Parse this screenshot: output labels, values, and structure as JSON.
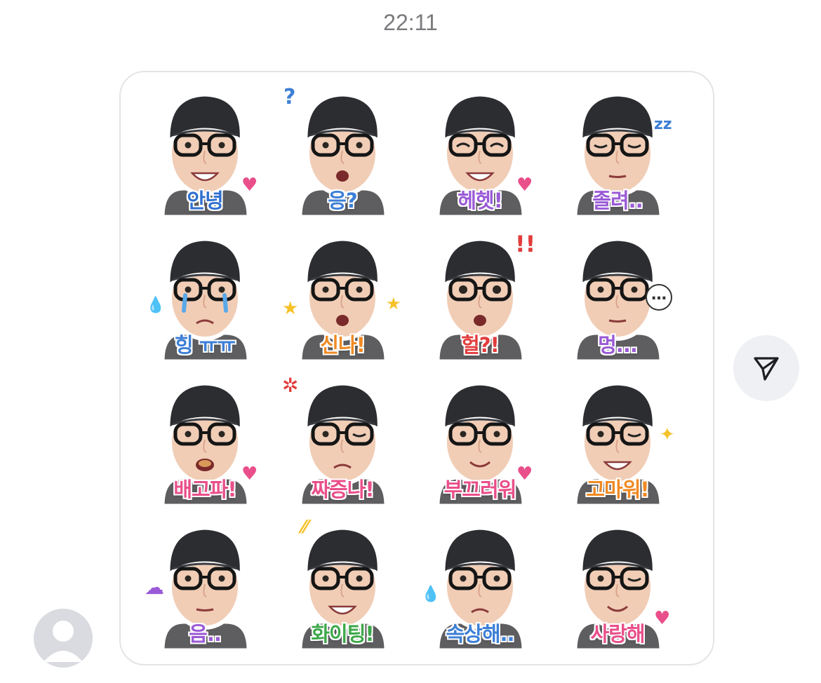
{
  "timestamp": "22:11",
  "colors": {
    "pink": "#e94f8a",
    "blue": "#3d7fd6",
    "purple": "#9a5ad6",
    "orange": "#f08a24",
    "green": "#3ea84a",
    "yellow": "#f6c22a",
    "red": "#e23c3c"
  },
  "stickers": [
    {
      "caption": "안녕",
      "color": "#2f6fd0",
      "icon": "heart-icon"
    },
    {
      "caption": "응?",
      "color": "#3d7fd6",
      "icon": "question-icon"
    },
    {
      "caption": "헤헷!",
      "color": "#9a5ad6",
      "icon": "heart-icon"
    },
    {
      "caption": "졸려..",
      "color": "#9a5ad6",
      "icon": "zzz-icon"
    },
    {
      "caption": "힝 ㅠㅠ",
      "color": "#3d7fd6",
      "icon": "tear-icon"
    },
    {
      "caption": "신나!",
      "color": "#f08a24",
      "icon": "star-icon"
    },
    {
      "caption": "헐?!",
      "color": "#e23c3c",
      "icon": "exclamation-icon"
    },
    {
      "caption": "멍...",
      "color": "#9a5ad6",
      "icon": "ellipsis-bubble-icon"
    },
    {
      "caption": "배고파!",
      "color": "#e94f8a",
      "icon": "heart-icon"
    },
    {
      "caption": "짜증나!",
      "color": "#e94f8a",
      "icon": "anger-icon"
    },
    {
      "caption": "부끄러워",
      "color": "#e94f8a",
      "icon": "heart-icon"
    },
    {
      "caption": "고마워!",
      "color": "#f08a24",
      "icon": "sparkle-icon"
    },
    {
      "caption": "음..",
      "color": "#9a5ad6",
      "icon": "thought-icon"
    },
    {
      "caption": "화이팅!",
      "color": "#3ea84a",
      "icon": "sparkle-lines-icon"
    },
    {
      "caption": "속상해..",
      "color": "#3d7fd6",
      "icon": "tear-icon"
    },
    {
      "caption": "사랑해",
      "color": "#e94f8a",
      "icon": "heart-icon"
    }
  ],
  "send_icon": "send-icon",
  "avatar_icon": "default-avatar-icon"
}
